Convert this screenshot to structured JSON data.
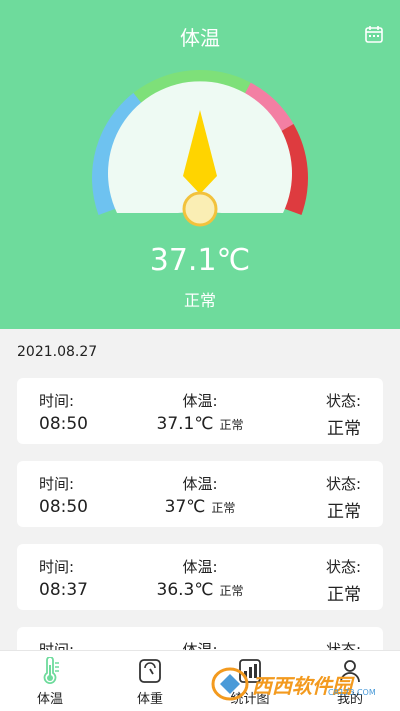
{
  "header": {
    "title": "体温",
    "calendar_icon": "calendar-icon"
  },
  "gauge": {
    "value": 37.1,
    "segments": [
      "#6ec2f0",
      "#7ee079",
      "#f37fa3",
      "#de3b3f"
    ],
    "needle_color": "#ffd400"
  },
  "current": {
    "temperature": "37.1℃",
    "status": "正常"
  },
  "date": "2021.08.27",
  "records": [
    {
      "time_label": "时间:",
      "time": "08:50",
      "temp_label": "体温:",
      "temp": "37.1℃",
      "temp_note": "正常",
      "status_label": "状态:",
      "status": "正常"
    },
    {
      "time_label": "时间:",
      "time": "08:50",
      "temp_label": "体温:",
      "temp": "37℃",
      "temp_note": "正常",
      "status_label": "状态:",
      "status": "正常"
    },
    {
      "time_label": "时间:",
      "time": "08:37",
      "temp_label": "体温:",
      "temp": "36.3℃",
      "temp_note": "正常",
      "status_label": "状态:",
      "status": "正常"
    },
    {
      "time_label": "时间:",
      "time": "",
      "temp_label": "体温:",
      "temp": "",
      "temp_note": "",
      "status_label": "状态:",
      "status": ""
    }
  ],
  "tabs": [
    {
      "label": "体温",
      "icon": "thermometer-icon",
      "active": true
    },
    {
      "label": "体重",
      "icon": "scale-icon",
      "active": false
    },
    {
      "label": "统计图",
      "icon": "chart-icon",
      "active": false
    },
    {
      "label": "我的",
      "icon": "user-icon",
      "active": false
    }
  ],
  "watermark": {
    "text": "西西软件园",
    "sub": "CR173.COM"
  }
}
